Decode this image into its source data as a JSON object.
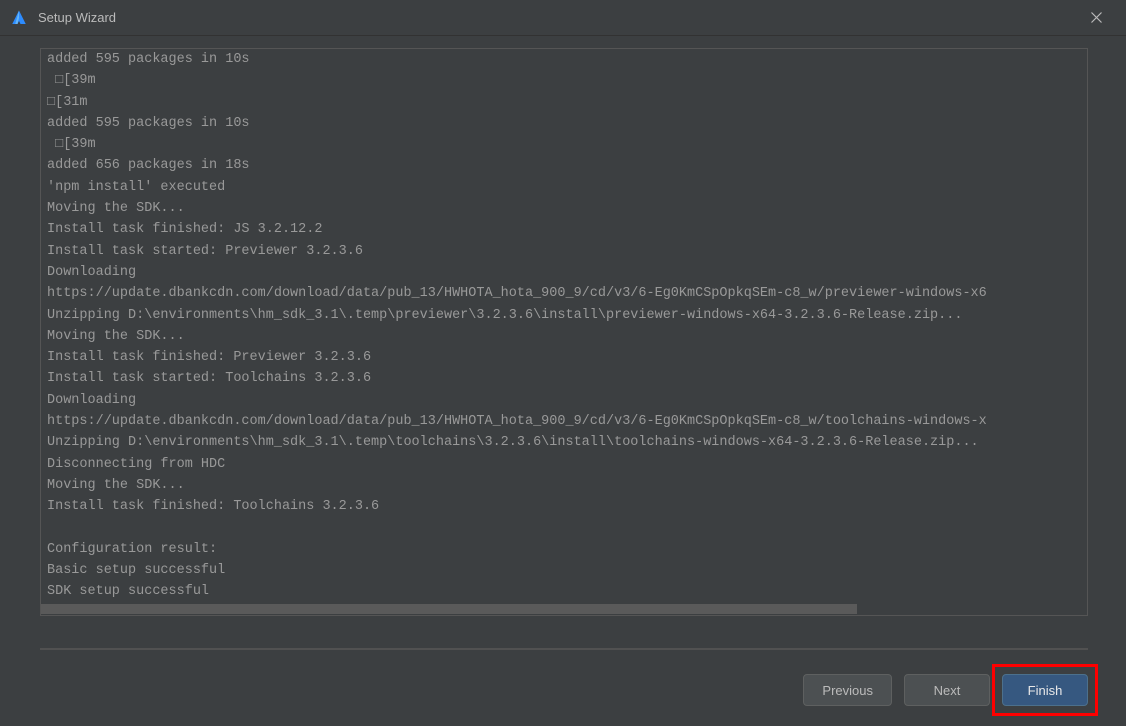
{
  "window": {
    "title": "Setup Wizard"
  },
  "log_lines": [
    "added 595 packages in 10s",
    " □[39m",
    "□[31m",
    "added 595 packages in 10s",
    " □[39m",
    "added 656 packages in 18s",
    "'npm install' executed",
    "Moving the SDK...",
    "Install task finished: JS 3.2.12.2",
    "Install task started: Previewer 3.2.3.6",
    "Downloading",
    "https://update.dbankcdn.com/download/data/pub_13/HWHOTA_hota_900_9/cd/v3/6-Eg0KmCSpOpkqSEm-c8_w/previewer-windows-x6",
    "Unzipping D:\\environments\\hm_sdk_3.1\\.temp\\previewer\\3.2.3.6\\install\\previewer-windows-x64-3.2.3.6-Release.zip...",
    "Moving the SDK...",
    "Install task finished: Previewer 3.2.3.6",
    "Install task started: Toolchains 3.2.3.6",
    "Downloading",
    "https://update.dbankcdn.com/download/data/pub_13/HWHOTA_hota_900_9/cd/v3/6-Eg0KmCSpOpkqSEm-c8_w/toolchains-windows-x",
    "Unzipping D:\\environments\\hm_sdk_3.1\\.temp\\toolchains\\3.2.3.6\\install\\toolchains-windows-x64-3.2.3.6-Release.zip...",
    "Disconnecting from HDC",
    "Moving the SDK...",
    "Install task finished: Toolchains 3.2.3.6",
    "",
    "Configuration result:",
    "Basic setup successful",
    "SDK setup successful"
  ],
  "buttons": {
    "previous": "Previous",
    "next": "Next",
    "finish": "Finish"
  }
}
